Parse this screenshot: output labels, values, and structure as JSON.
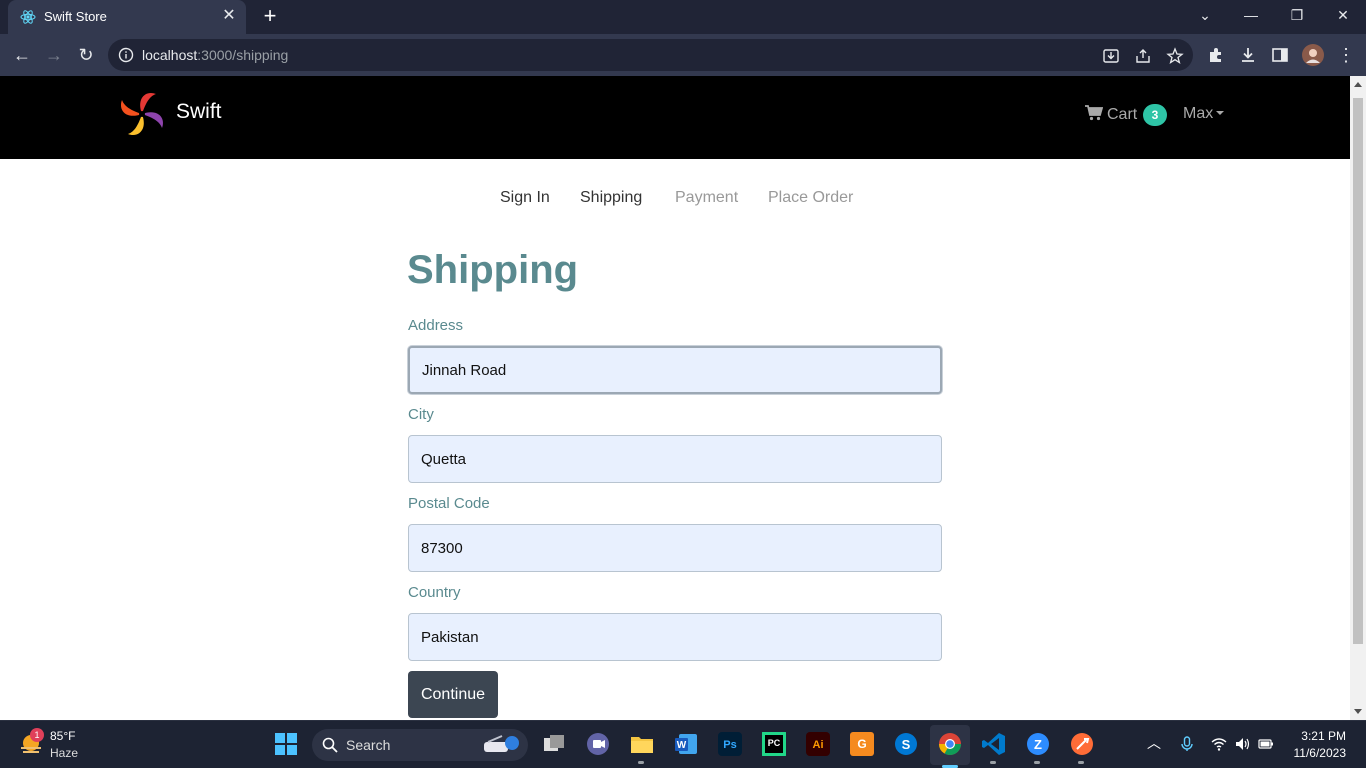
{
  "browser": {
    "tab_title": "Swift Store",
    "url_host": "localhost",
    "url_rest": ":3000/shipping",
    "close_tab": "✕",
    "new_tab": "+"
  },
  "header": {
    "brand": "Swift",
    "cart_label": "Cart",
    "cart_count": "3",
    "user_name": "Max"
  },
  "steps": [
    {
      "label": "Sign In",
      "state": "active"
    },
    {
      "label": "Shipping",
      "state": "active"
    },
    {
      "label": "Payment",
      "state": "disabled"
    },
    {
      "label": "Place Order",
      "state": "disabled"
    }
  ],
  "form": {
    "title": "Shipping",
    "address_label": "Address",
    "address_value": "Jinnah Road",
    "city_label": "City",
    "city_value": "Quetta",
    "postal_label": "Postal Code",
    "postal_value": "87300",
    "country_label": "Country",
    "country_value": "Pakistan",
    "submit_label": "Continue"
  },
  "taskbar": {
    "weather_temp": "85°F",
    "weather_desc": "Haze",
    "weather_badge": "1",
    "search_label": "Search",
    "time": "3:21 PM",
    "date": "11/6/2023"
  },
  "colors": {
    "accent": "#5a8a8f",
    "badge": "#2ec4a6",
    "button": "#3c4652"
  }
}
